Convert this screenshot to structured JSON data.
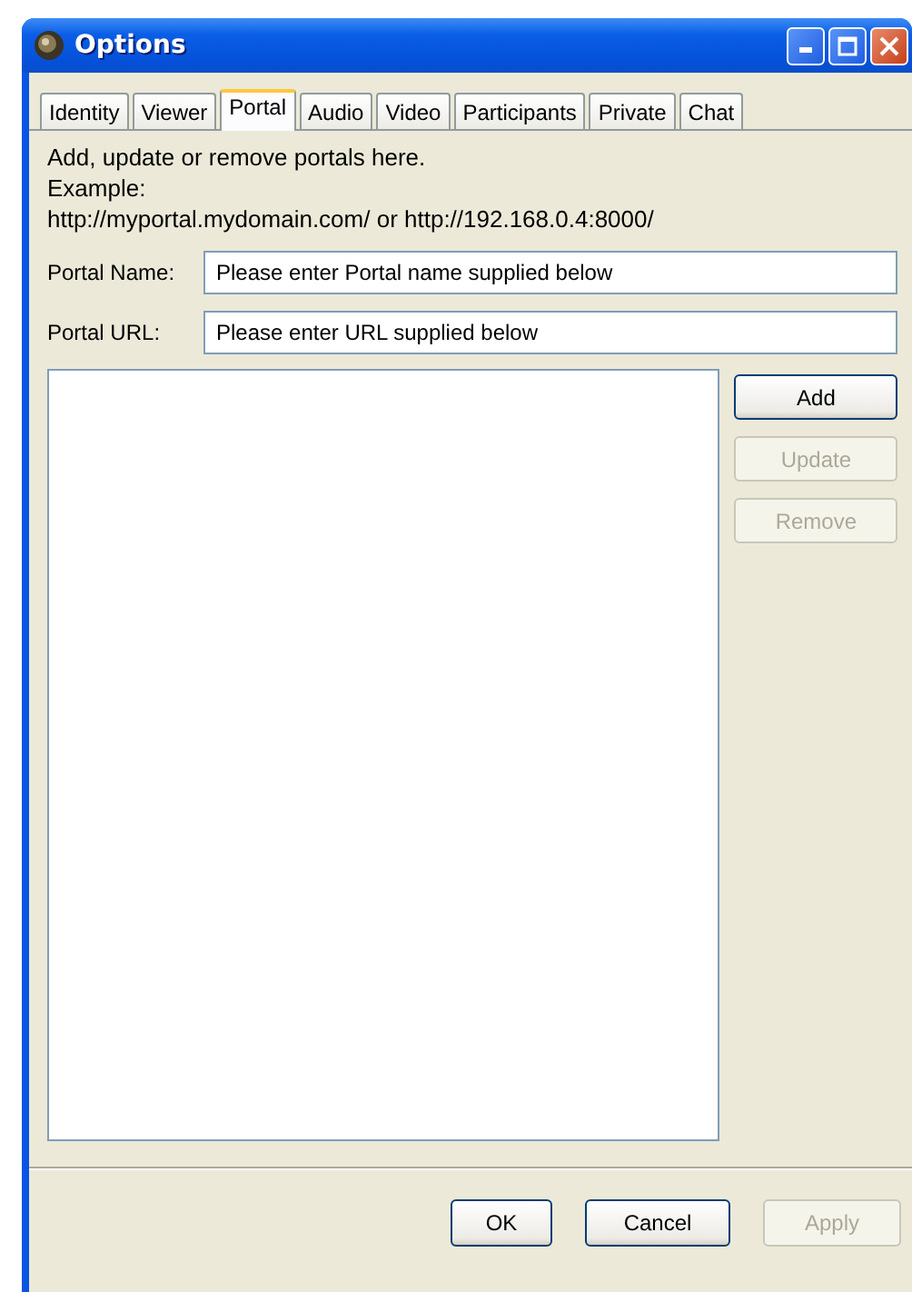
{
  "window": {
    "title": "Options"
  },
  "tabs": [
    {
      "label": "Identity",
      "selected": false
    },
    {
      "label": "Viewer",
      "selected": false
    },
    {
      "label": "Portal",
      "selected": true
    },
    {
      "label": "Audio",
      "selected": false
    },
    {
      "label": "Video",
      "selected": false
    },
    {
      "label": "Participants",
      "selected": false
    },
    {
      "label": "Private",
      "selected": false
    },
    {
      "label": "Chat",
      "selected": false
    }
  ],
  "intro": [
    "Add, update or remove portals here.",
    "Example:",
    "http://myportal.mydomain.com/ or http://192.168.0.4:8000/"
  ],
  "fields": [
    {
      "label": "Portal Name:",
      "value": "Please enter Portal name supplied below"
    },
    {
      "label": "Portal URL:",
      "value": "Please enter URL supplied below"
    }
  ],
  "side_buttons": [
    {
      "label": "Add",
      "disabled": false
    },
    {
      "label": "Update",
      "disabled": true
    },
    {
      "label": "Remove",
      "disabled": true
    }
  ],
  "footer_buttons": [
    {
      "label": "OK",
      "disabled": false
    },
    {
      "label": "Cancel",
      "disabled": false
    },
    {
      "label": "Apply",
      "disabled": true
    }
  ]
}
